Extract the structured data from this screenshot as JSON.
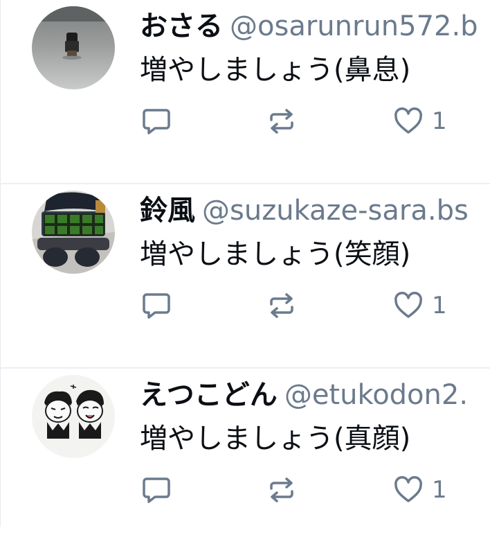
{
  "posts": [
    {
      "display_name": "おさる",
      "handle": "@osarunrun572.b",
      "text": "増やしましょう(鼻息)",
      "like_count": "1",
      "avatar_icon": "avatar-photo-figure-icon"
    },
    {
      "display_name": "鈴風",
      "handle": "@suzukaze-sara.bs",
      "text": "増やしましょう(笑顔)",
      "like_count": "1",
      "avatar_icon": "avatar-photo-plush-icon"
    },
    {
      "display_name": "えつこどん",
      "handle": "@etukodon2.",
      "text": "増やしましょう(真顔)",
      "like_count": "1",
      "avatar_icon": "avatar-drawing-icon"
    }
  ],
  "icons": {
    "reply": "reply-icon",
    "repost": "repost-icon",
    "like": "heart-icon"
  },
  "colors": {
    "text": "#0b0f14",
    "muted": "#6b7a8d",
    "divider": "#eceff3"
  }
}
